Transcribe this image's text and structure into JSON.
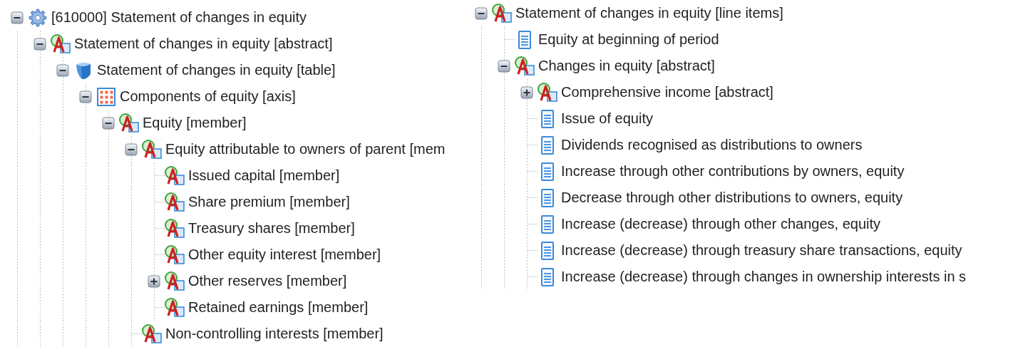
{
  "left_tree": [
    {
      "label": "[610000] Statement of changes in equity",
      "kind": "group",
      "expanded": true,
      "children": [
        {
          "label": "Statement of changes in equity [abstract]",
          "kind": "abstract",
          "expanded": true,
          "children": [
            {
              "label": "Statement of changes in equity [table]",
              "kind": "table",
              "expanded": true,
              "children": [
                {
                  "label": "Components of equity [axis]",
                  "kind": "axis",
                  "expanded": true,
                  "children": [
                    {
                      "label": "Equity [member]",
                      "kind": "abstract",
                      "expanded": true,
                      "children": [
                        {
                          "label": "Equity attributable to owners of parent [mem",
                          "kind": "abstract",
                          "expanded": true,
                          "children": [
                            {
                              "label": "Issued capital [member]",
                              "kind": "abstract"
                            },
                            {
                              "label": "Share premium [member]",
                              "kind": "abstract"
                            },
                            {
                              "label": "Treasury shares [member]",
                              "kind": "abstract"
                            },
                            {
                              "label": "Other equity interest [member]",
                              "kind": "abstract"
                            },
                            {
                              "label": "Other reserves [member]",
                              "kind": "abstract",
                              "expanded": false
                            },
                            {
                              "label": "Retained earnings [member]",
                              "kind": "abstract"
                            }
                          ]
                        },
                        {
                          "label": "Non-controlling interests [member]",
                          "kind": "abstract"
                        }
                      ]
                    }
                  ]
                }
              ]
            }
          ]
        }
      ]
    }
  ],
  "right_tree": [
    {
      "label": "Statement of changes in equity [line items]",
      "kind": "abstract",
      "expanded": true,
      "children": [
        {
          "label": "Equity at beginning of period",
          "kind": "item"
        },
        {
          "label": "Changes in equity [abstract]",
          "kind": "abstract",
          "expanded": true,
          "children": [
            {
              "label": "Comprehensive income [abstract]",
              "kind": "abstract",
              "expanded": false
            },
            {
              "label": "Issue of equity",
              "kind": "item"
            },
            {
              "label": "Dividends recognised as distributions to owners",
              "kind": "item"
            },
            {
              "label": "Increase through other contributions by owners, equity",
              "kind": "item"
            },
            {
              "label": "Decrease through other distributions to owners, equity",
              "kind": "item"
            },
            {
              "label": "Increase (decrease) through other changes, equity",
              "kind": "item"
            },
            {
              "label": "Increase (decrease) through treasury share transactions, equity",
              "kind": "item"
            },
            {
              "label": "Increase (decrease) through changes in ownership interests in s",
              "kind": "item"
            }
          ]
        }
      ]
    }
  ]
}
